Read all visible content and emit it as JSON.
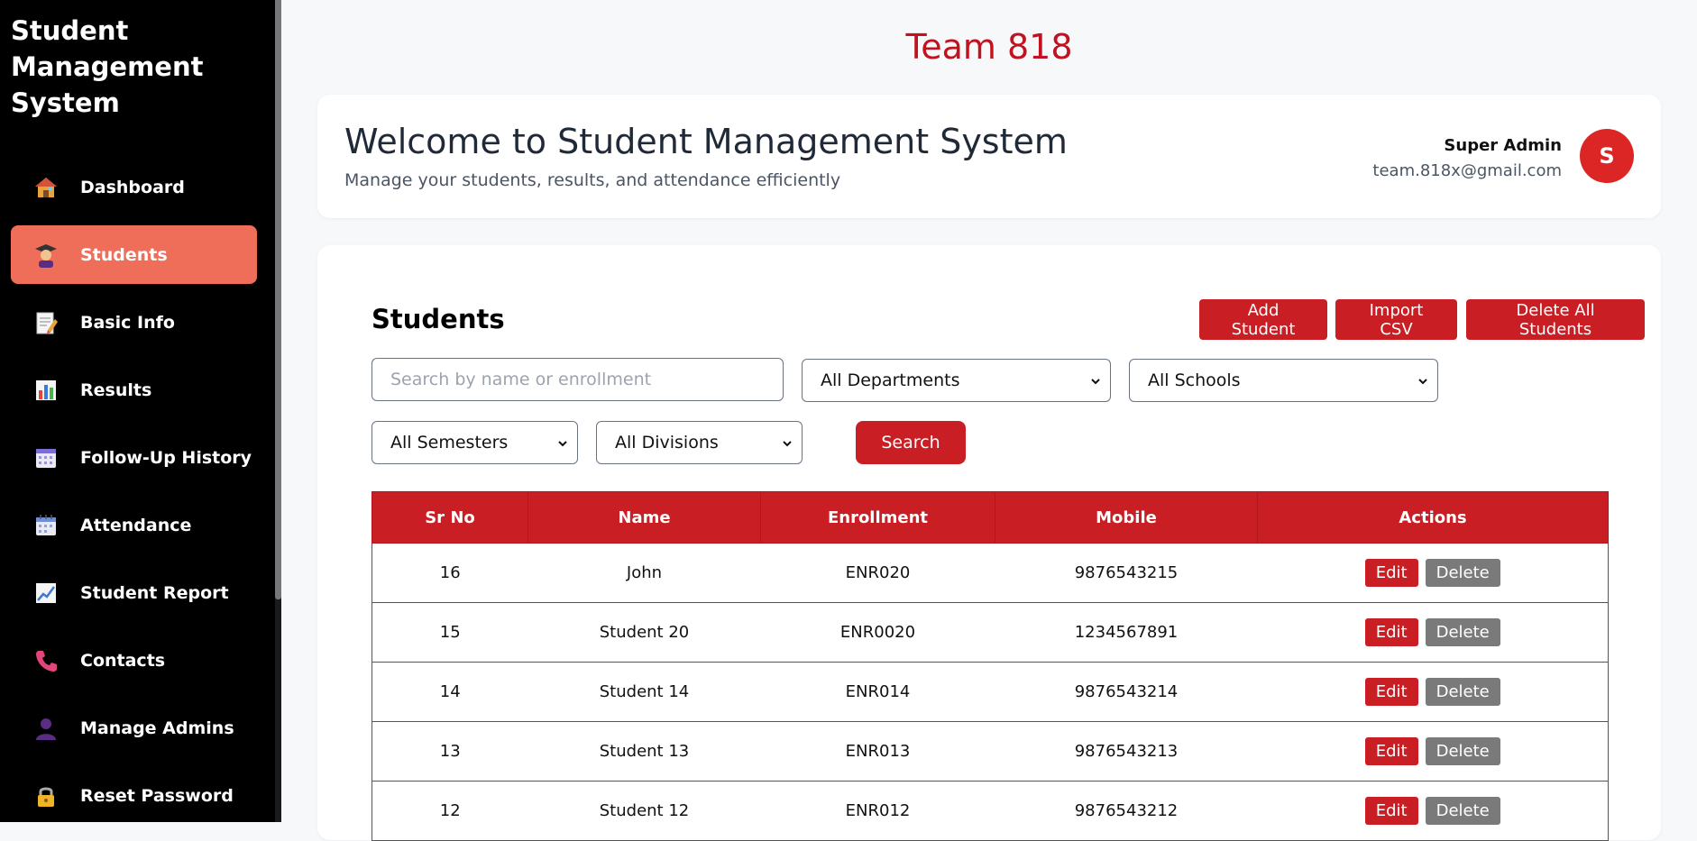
{
  "sidebar": {
    "brand": "Student Management System",
    "items": [
      {
        "label": "Dashboard",
        "icon": "house-icon"
      },
      {
        "label": "Students",
        "icon": "student-icon",
        "active": true
      },
      {
        "label": "Basic Info",
        "icon": "memo-icon"
      },
      {
        "label": "Results",
        "icon": "bar-chart-icon"
      },
      {
        "label": "Follow-Up History",
        "icon": "calendar-icon"
      },
      {
        "label": "Attendance",
        "icon": "calendar-spiral-icon"
      },
      {
        "label": "Student Report",
        "icon": "chart-up-icon"
      },
      {
        "label": "Contacts",
        "icon": "phone-icon"
      },
      {
        "label": "Manage Admins",
        "icon": "user-icon"
      },
      {
        "label": "Reset Password",
        "icon": "lock-icon"
      }
    ]
  },
  "header": {
    "team": "Team 818",
    "welcome_title": "Welcome to Student Management System",
    "welcome_subtitle": "Manage your students, results, and attendance efficiently",
    "user_name": "Super Admin",
    "user_email": "team.818x@gmail.com",
    "avatar_letter": "S"
  },
  "students": {
    "title": "Students",
    "add_label": "Add Student",
    "import_label": "Import CSV",
    "delete_all_label": "Delete All Students",
    "search_placeholder": "Search by name or enrollment",
    "department_filter": "All Departments",
    "school_filter": "All Schools",
    "semester_filter": "All Semesters",
    "division_filter": "All Divisions",
    "search_label": "Search",
    "columns": [
      "Sr No",
      "Name",
      "Enrollment",
      "Mobile",
      "Actions"
    ],
    "edit_label": "Edit",
    "delete_label": "Delete",
    "rows": [
      {
        "sr": "16",
        "name": "John",
        "enrollment": "ENR020",
        "mobile": "9876543215"
      },
      {
        "sr": "15",
        "name": "Student 20",
        "enrollment": "ENR0020",
        "mobile": "1234567891"
      },
      {
        "sr": "14",
        "name": "Student 14",
        "enrollment": "ENR014",
        "mobile": "9876543214"
      },
      {
        "sr": "13",
        "name": "Student 13",
        "enrollment": "ENR013",
        "mobile": "9876543213"
      },
      {
        "sr": "12",
        "name": "Student 12",
        "enrollment": "ENR012",
        "mobile": "9876543212"
      }
    ]
  },
  "colors": {
    "accent": "#c81e24",
    "active_nav": "#ee6e5a",
    "sidebar_bg": "#000000",
    "team_text": "#c1121f"
  }
}
